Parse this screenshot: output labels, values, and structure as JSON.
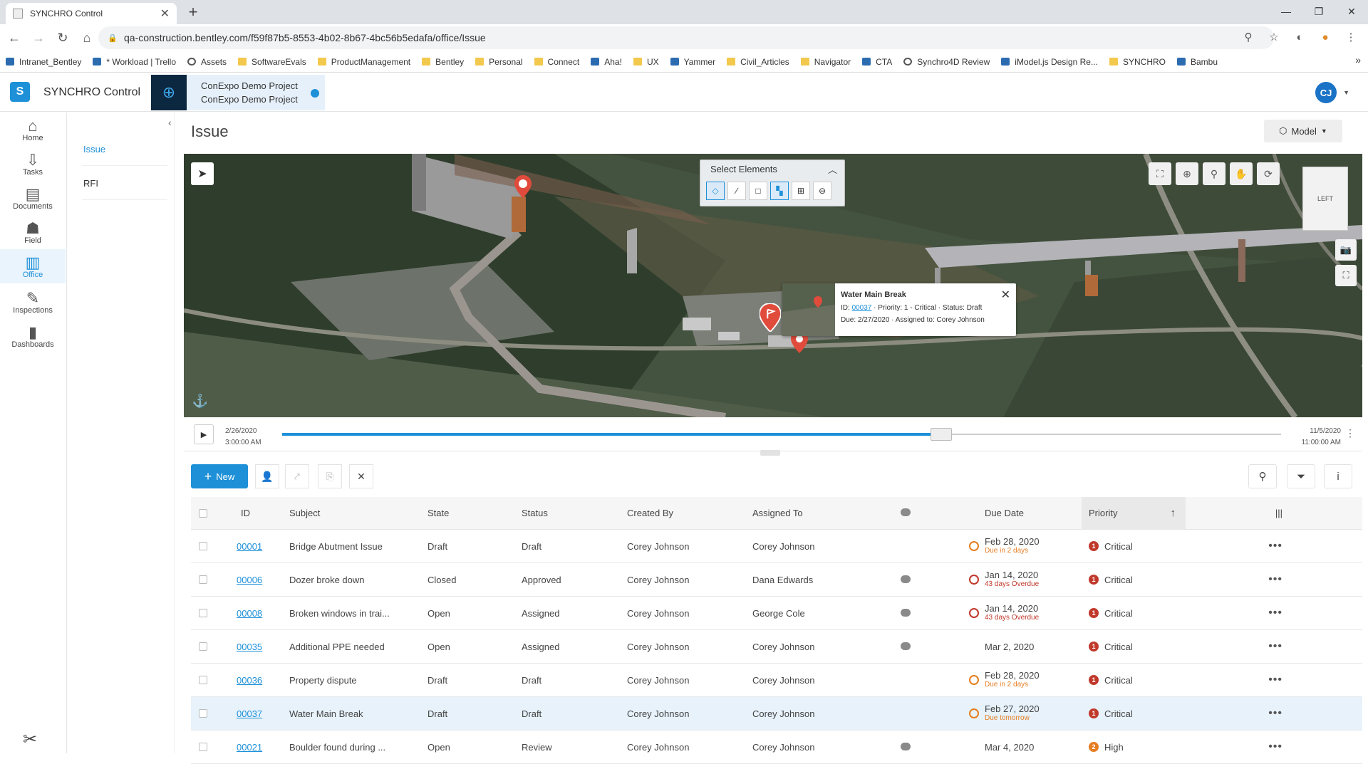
{
  "browser": {
    "tab_title": "SYNCHRO Control",
    "url": "qa-construction.bentley.com/f59f87b5-8553-4b02-8b67-4bc56b5edafa/office/Issue",
    "bookmarks": [
      {
        "label": "Intranet_Bentley",
        "icon": "app"
      },
      {
        "label": "* Workload | Trello",
        "icon": "app"
      },
      {
        "label": "Assets",
        "icon": "ring"
      },
      {
        "label": "SoftwareEvals",
        "icon": "folder"
      },
      {
        "label": "ProductManagement",
        "icon": "folder"
      },
      {
        "label": "Bentley",
        "icon": "folder"
      },
      {
        "label": "Personal",
        "icon": "folder"
      },
      {
        "label": "Connect",
        "icon": "folder"
      },
      {
        "label": "Aha!",
        "icon": "app"
      },
      {
        "label": "UX",
        "icon": "folder"
      },
      {
        "label": "Yammer",
        "icon": "app"
      },
      {
        "label": "Civil_Articles",
        "icon": "folder"
      },
      {
        "label": "Navigator",
        "icon": "folder"
      },
      {
        "label": "CTA",
        "icon": "app"
      },
      {
        "label": "Synchro4D Review",
        "icon": "ring"
      },
      {
        "label": "iModel.js Design Re...",
        "icon": "app"
      },
      {
        "label": "SYNCHRO",
        "icon": "folder"
      },
      {
        "label": "Bambu",
        "icon": "app"
      }
    ],
    "bookmarks_more": "»"
  },
  "app": {
    "name": "SYNCHRO Control",
    "project_line1": "ConExpo Demo Project",
    "project_line2": "ConExpo Demo Project",
    "user_initials": "CJ"
  },
  "rail": [
    {
      "label": "Home",
      "glyph": "⌂"
    },
    {
      "label": "Tasks",
      "glyph": "⇩"
    },
    {
      "label": "Documents",
      "glyph": "▤"
    },
    {
      "label": "Field",
      "glyph": "☗"
    },
    {
      "label": "Office",
      "glyph": "▥"
    },
    {
      "label": "Inspections",
      "glyph": "✎"
    },
    {
      "label": "Dashboards",
      "glyph": "▮"
    }
  ],
  "subnav": [
    "Issue",
    "RFI"
  ],
  "page": {
    "title": "Issue",
    "model_button": "Model"
  },
  "viewer": {
    "select_panel_title": "Select Elements",
    "navcube_label": "LEFT",
    "popup": {
      "title": "Water Main Break",
      "id_prefix": "ID:",
      "id": "00037",
      "rest1": "· Priority: 1 - Critical · Status: Draft",
      "line2": "Due: 2/27/2020 · Assigned to: Corey Johnson"
    }
  },
  "timeline": {
    "start_date": "2/26/2020",
    "start_time": "3:00:00 AM",
    "end_date": "11/5/2020",
    "end_time": "11:00:00 AM",
    "progress": 0.66
  },
  "toolbar": {
    "new_label": "New"
  },
  "table": {
    "headers": {
      "id": "ID",
      "subject": "Subject",
      "state": "State",
      "status": "Status",
      "created_by": "Created By",
      "assigned_to": "Assigned To",
      "due_date": "Due Date",
      "priority": "Priority"
    },
    "rows": [
      {
        "id": "00001",
        "subject": "Bridge Abutment Issue",
        "state": "Draft",
        "status": "Draft",
        "created_by": "Corey Johnson",
        "assigned_to": "Corey Johnson",
        "comment": false,
        "due": "Feb 28, 2020",
        "due_note": "Due in 2 days",
        "due_kind": "soon",
        "priority": "Critical",
        "pnum": "1"
      },
      {
        "id": "00006",
        "subject": "Dozer broke down",
        "state": "Closed",
        "status": "Approved",
        "created_by": "Corey Johnson",
        "assigned_to": "Dana Edwards",
        "comment": true,
        "due": "Jan 14, 2020",
        "due_note": "43 days Overdue",
        "due_kind": "overdue",
        "priority": "Critical",
        "pnum": "1"
      },
      {
        "id": "00008",
        "subject": "Broken windows in trai...",
        "state": "Open",
        "status": "Assigned",
        "created_by": "Corey Johnson",
        "assigned_to": "George Cole",
        "comment": true,
        "due": "Jan 14, 2020",
        "due_note": "43 days Overdue",
        "due_kind": "overdue",
        "priority": "Critical",
        "pnum": "1"
      },
      {
        "id": "00035",
        "subject": "Additional PPE needed",
        "state": "Open",
        "status": "Assigned",
        "created_by": "Corey Johnson",
        "assigned_to": "Corey Johnson",
        "comment": true,
        "due": "Mar 2, 2020",
        "due_note": "",
        "due_kind": "none",
        "priority": "Critical",
        "pnum": "1"
      },
      {
        "id": "00036",
        "subject": "Property dispute",
        "state": "Draft",
        "status": "Draft",
        "created_by": "Corey Johnson",
        "assigned_to": "Corey Johnson",
        "comment": false,
        "due": "Feb 28, 2020",
        "due_note": "Due in 2 days",
        "due_kind": "soon",
        "priority": "Critical",
        "pnum": "1"
      },
      {
        "id": "00037",
        "subject": "Water Main Break",
        "state": "Draft",
        "status": "Draft",
        "created_by": "Corey Johnson",
        "assigned_to": "Corey Johnson",
        "comment": false,
        "due": "Feb 27, 2020",
        "due_note": "Due tomorrow",
        "due_kind": "soon",
        "priority": "Critical",
        "pnum": "1",
        "selected": true
      },
      {
        "id": "00021",
        "subject": "Boulder found during ...",
        "state": "Open",
        "status": "Review",
        "created_by": "Corey Johnson",
        "assigned_to": "Corey Johnson",
        "comment": true,
        "due": "Mar 4, 2020",
        "due_note": "",
        "due_kind": "none",
        "priority": "High",
        "pnum": "2"
      }
    ]
  },
  "colors": {
    "accent": "#1d90d8",
    "critical": "#c0392b",
    "high": "#e67e22",
    "soon": "#e67e22",
    "overdue": "#c0392b"
  }
}
